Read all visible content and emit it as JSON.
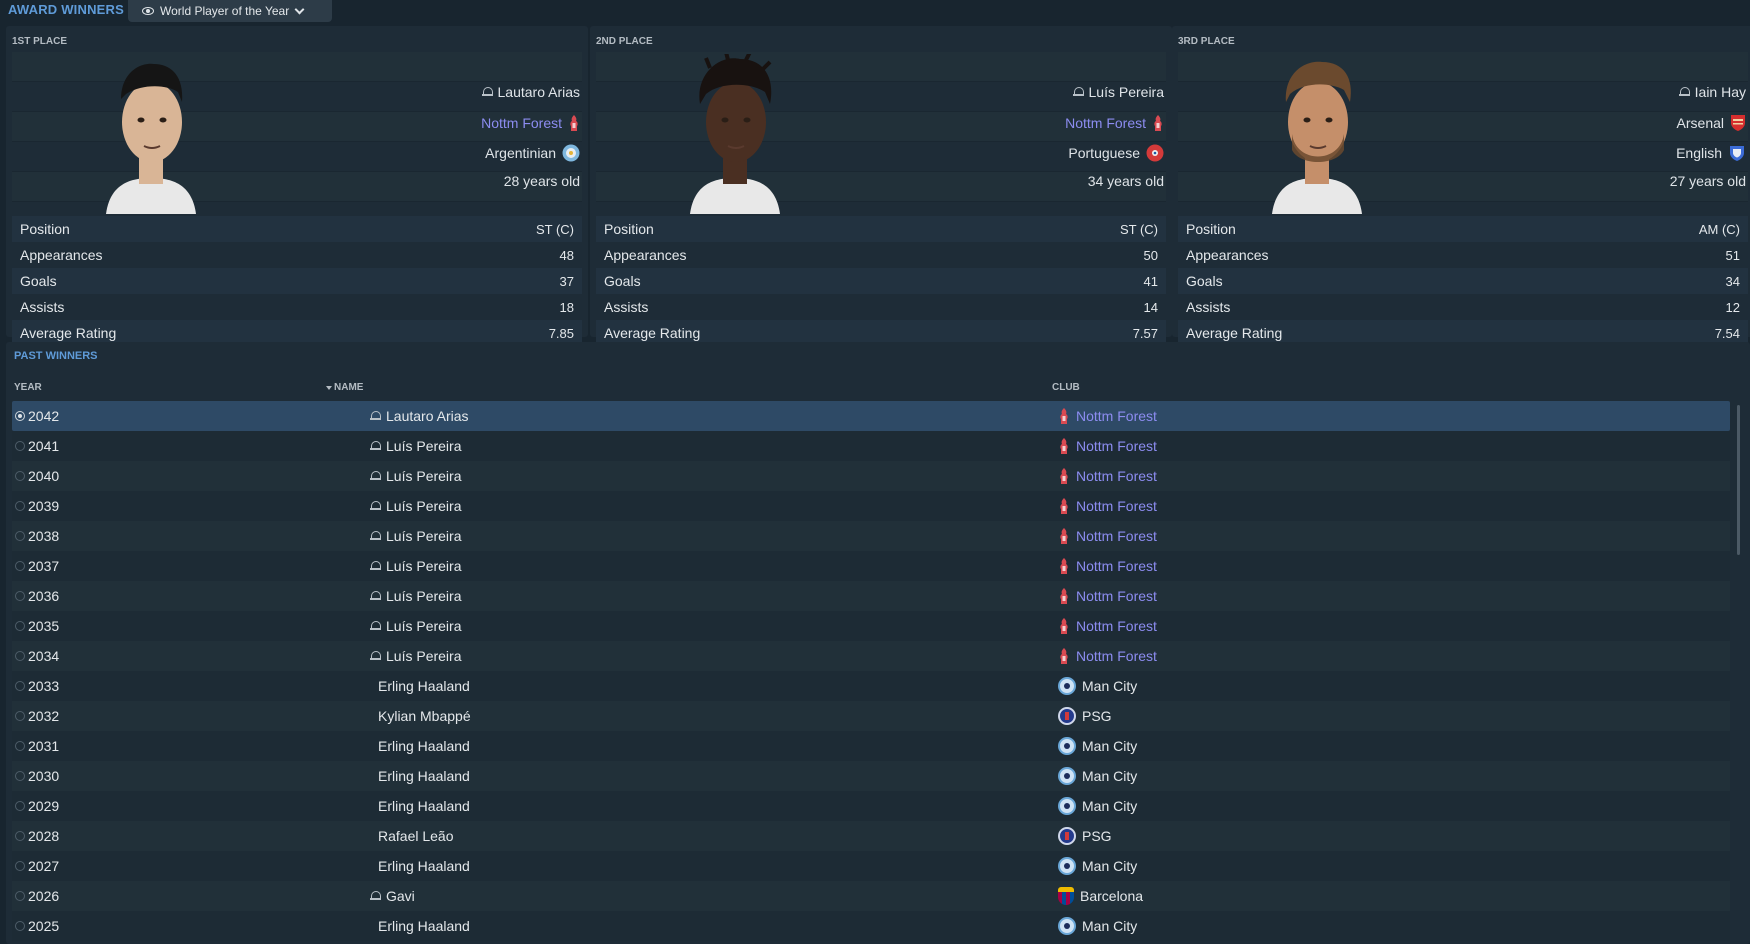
{
  "header": {
    "title": "AWARD WINNERS",
    "award_selector": "World Player of the Year"
  },
  "colors": {
    "accent": "#5f9bd8",
    "link": "#8c8cf0",
    "selected_row": "#2e4a66"
  },
  "podium": [
    {
      "place": "1ST PLACE",
      "name": "Lautaro Arias",
      "club": "Nottm Forest",
      "nationality": "Argentinian",
      "age": "28 years old",
      "stats": [
        {
          "label": "Position",
          "value": "ST (C)"
        },
        {
          "label": "Appearances",
          "value": "48"
        },
        {
          "label": "Goals",
          "value": "37"
        },
        {
          "label": "Assists",
          "value": "18"
        },
        {
          "label": "Average Rating",
          "value": "7.85"
        }
      ]
    },
    {
      "place": "2ND PLACE",
      "name": "Luís Pereira",
      "club": "Nottm Forest",
      "nationality": "Portuguese",
      "age": "34 years old",
      "stats": [
        {
          "label": "Position",
          "value": "ST (C)"
        },
        {
          "label": "Appearances",
          "value": "50"
        },
        {
          "label": "Goals",
          "value": "41"
        },
        {
          "label": "Assists",
          "value": "14"
        },
        {
          "label": "Average Rating",
          "value": "7.57"
        }
      ]
    },
    {
      "place": "3RD PLACE",
      "name": "Iain Hay",
      "club": "Arsenal",
      "nationality": "English",
      "age": "27 years old",
      "stats": [
        {
          "label": "Position",
          "value": "AM (C)"
        },
        {
          "label": "Appearances",
          "value": "51"
        },
        {
          "label": "Goals",
          "value": "34"
        },
        {
          "label": "Assists",
          "value": "12"
        },
        {
          "label": "Average Rating",
          "value": "7.54"
        }
      ]
    }
  ],
  "past_winners": {
    "title": "PAST WINNERS",
    "columns": {
      "year": "YEAR",
      "name": "NAME",
      "club": "CLUB"
    },
    "rows": [
      {
        "year": "2042",
        "name": "Lautaro Arias",
        "club": "Nottm Forest",
        "crest": "forest",
        "person_icon": true,
        "link": true
      },
      {
        "year": "2041",
        "name": "Luís Pereira",
        "club": "Nottm Forest",
        "crest": "forest",
        "person_icon": true,
        "link": true
      },
      {
        "year": "2040",
        "name": "Luís Pereira",
        "club": "Nottm Forest",
        "crest": "forest",
        "person_icon": true,
        "link": true
      },
      {
        "year": "2039",
        "name": "Luís Pereira",
        "club": "Nottm Forest",
        "crest": "forest",
        "person_icon": true,
        "link": true
      },
      {
        "year": "2038",
        "name": "Luís Pereira",
        "club": "Nottm Forest",
        "crest": "forest",
        "person_icon": true,
        "link": true
      },
      {
        "year": "2037",
        "name": "Luís Pereira",
        "club": "Nottm Forest",
        "crest": "forest",
        "person_icon": true,
        "link": true
      },
      {
        "year": "2036",
        "name": "Luís Pereira",
        "club": "Nottm Forest",
        "crest": "forest",
        "person_icon": true,
        "link": true
      },
      {
        "year": "2035",
        "name": "Luís Pereira",
        "club": "Nottm Forest",
        "crest": "forest",
        "person_icon": true,
        "link": true
      },
      {
        "year": "2034",
        "name": "Luís Pereira",
        "club": "Nottm Forest",
        "crest": "forest",
        "person_icon": true,
        "link": true
      },
      {
        "year": "2033",
        "name": "Erling Haaland",
        "club": "Man City",
        "crest": "city",
        "person_icon": false,
        "link": false
      },
      {
        "year": "2032",
        "name": "Kylian Mbappé",
        "club": "PSG",
        "crest": "psg",
        "person_icon": false,
        "link": false
      },
      {
        "year": "2031",
        "name": "Erling Haaland",
        "club": "Man City",
        "crest": "city",
        "person_icon": false,
        "link": false
      },
      {
        "year": "2030",
        "name": "Erling Haaland",
        "club": "Man City",
        "crest": "city",
        "person_icon": false,
        "link": false
      },
      {
        "year": "2029",
        "name": "Erling Haaland",
        "club": "Man City",
        "crest": "city",
        "person_icon": false,
        "link": false
      },
      {
        "year": "2028",
        "name": "Rafael Leão",
        "club": "PSG",
        "crest": "psg",
        "person_icon": false,
        "link": false
      },
      {
        "year": "2027",
        "name": "Erling Haaland",
        "club": "Man City",
        "crest": "city",
        "person_icon": false,
        "link": false
      },
      {
        "year": "2026",
        "name": "Gavi",
        "club": "Barcelona",
        "crest": "barca",
        "person_icon": true,
        "link": false
      },
      {
        "year": "2025",
        "name": "Erling Haaland",
        "club": "Man City",
        "crest": "city",
        "person_icon": false,
        "link": false
      }
    ]
  }
}
